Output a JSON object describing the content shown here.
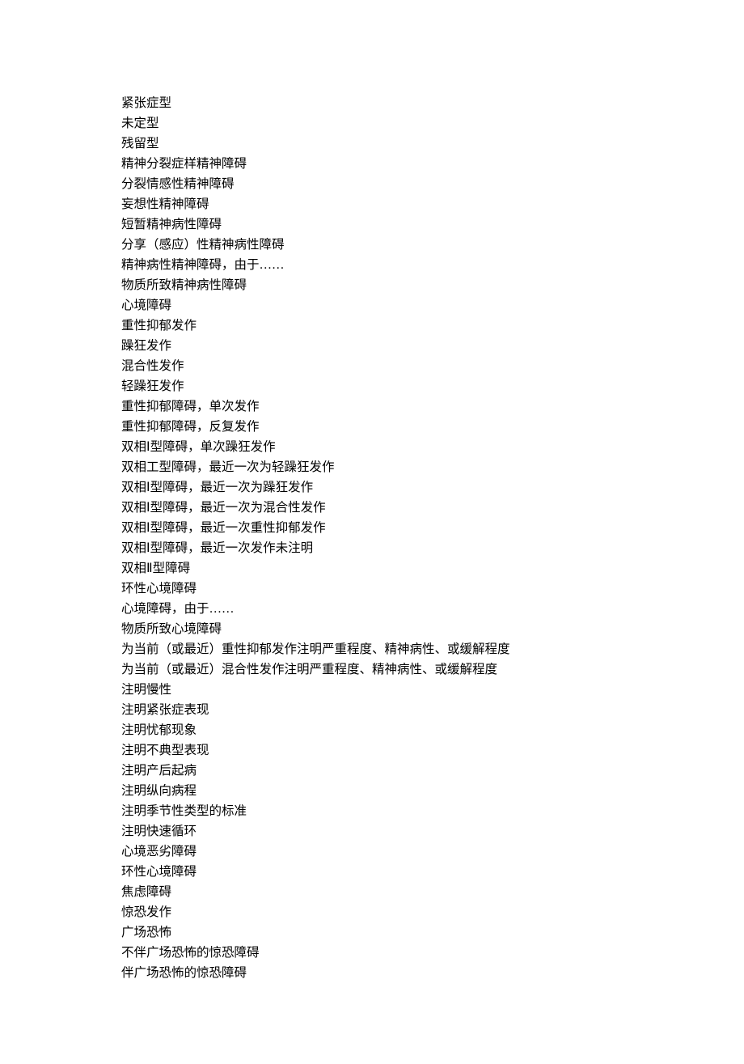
{
  "lines": [
    "紧张症型",
    "未定型",
    "残留型",
    "精神分裂症样精神障碍",
    "分裂情感性精神障碍",
    "妄想性精神障碍",
    "短暂精神病性障碍",
    "分享（感应）性精神病性障碍",
    "精神病性精神障碍，由于……",
    "物质所致精神病性障碍",
    "心境障碍",
    "重性抑郁发作",
    "躁狂发作",
    "混合性发作",
    "轻躁狂发作",
    "重性抑郁障碍，单次发作",
    "重性抑郁障碍，反复发作",
    "双相Ⅰ型障碍，单次躁狂发作",
    "双相工型障碍，最近一次为轻躁狂发作",
    "双相Ⅰ型障碍，最近一次为躁狂发作",
    "双相Ⅰ型障碍，最近一次为混合性发作",
    "双相Ⅰ型障碍，最近一次重性抑郁发作",
    "双相Ⅰ型障碍，最近一次发作未注明",
    "双相Ⅱ型障碍",
    "环性心境障碍",
    "心境障碍，由于……",
    "物质所致心境障碍",
    "为当前（或最近）重性抑郁发作注明严重程度、精神病性、或缓解程度",
    "为当前（或最近）混合性发作注明严重程度、精神病性、或缓解程度",
    "注明慢性",
    "注明紧张症表现",
    "注明忧郁现象",
    "注明不典型表现",
    "注明产后起病",
    "注明纵向病程",
    "注明季节性类型的标准",
    "注明快速循环",
    "心境恶劣障碍",
    "环性心境障碍",
    "焦虑障碍",
    "惊恐发作",
    "广场恐怖",
    "不伴广场恐怖的惊恐障碍",
    "伴广场恐怖的惊恐障碍"
  ]
}
